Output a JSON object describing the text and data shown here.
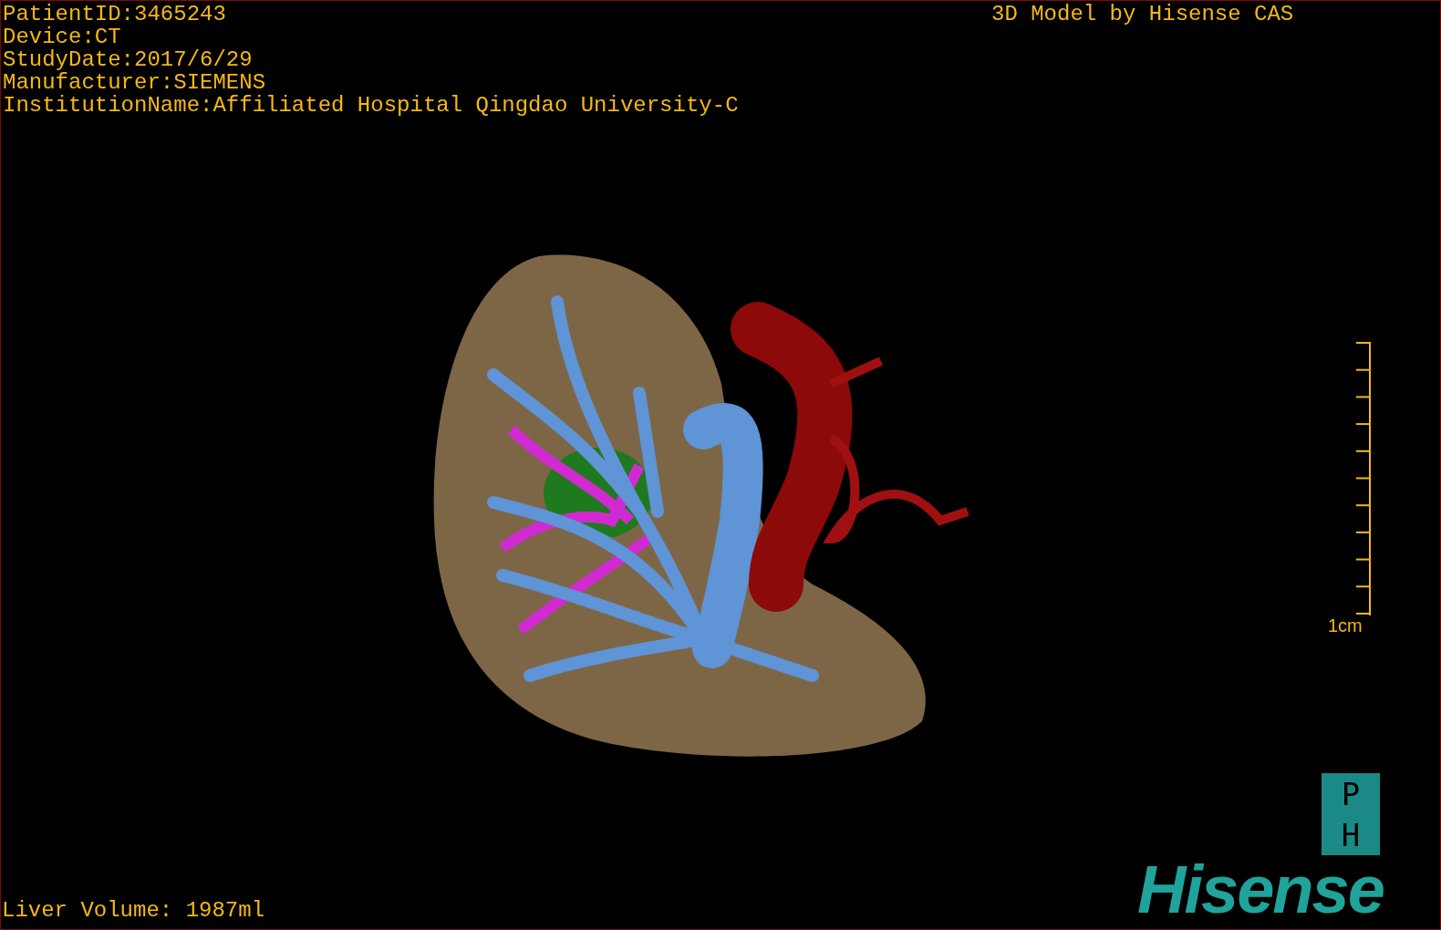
{
  "viewport": {
    "kind": "picture",
    "info_lines": [
      "PatientID:3465243",
      "Device:CT",
      "StudyDate:2017/6/29",
      "Manufacturer:SIEMENS",
      "InstitutionName:Affiliated Hospital Qingdao University-C"
    ],
    "title": "3D Model by Hisense CAS",
    "scale_label": "1cm",
    "volume": "Liver Volume: 1987ml",
    "logo": {
      "badge_letters": [
        "P",
        "H"
      ],
      "wordmark": "Hisense"
    }
  }
}
